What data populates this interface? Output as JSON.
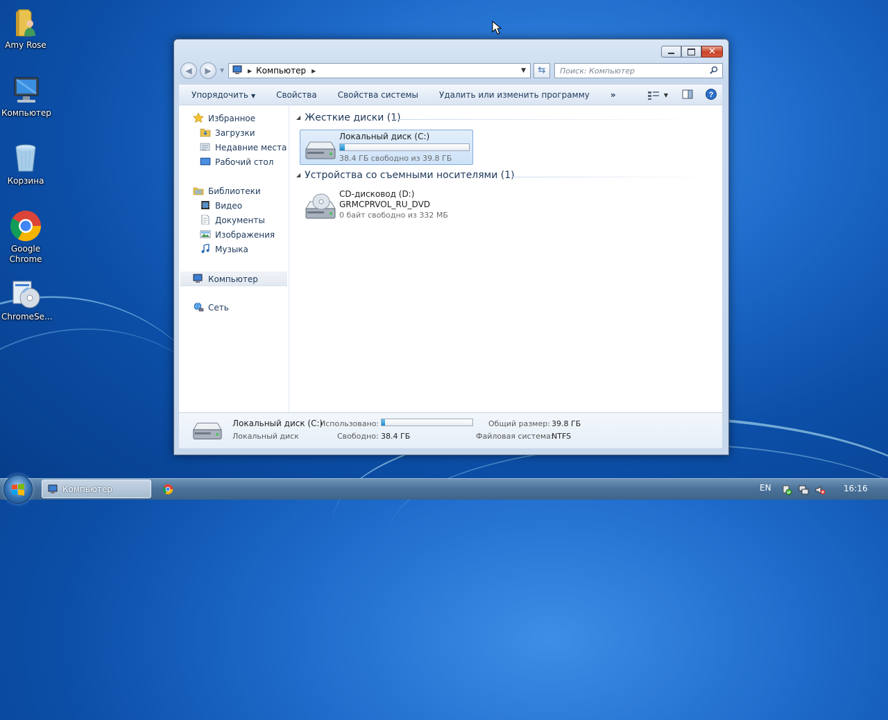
{
  "desktop": {
    "icons": [
      {
        "label": "Amy Rose"
      },
      {
        "label": "Компьютер"
      },
      {
        "label": "Корзина"
      },
      {
        "label": "Google Chrome"
      },
      {
        "label": "ChromeSe..."
      }
    ]
  },
  "window": {
    "address": {
      "location": "Компьютер"
    },
    "search": {
      "placeholder": "Поиск: Компьютер"
    },
    "toolbar": {
      "organize": "Упорядочить",
      "properties": "Свойства",
      "system_properties": "Свойства системы",
      "uninstall": "Удалить или изменить программу",
      "more": "»"
    },
    "nav": {
      "favorites": "Избранное",
      "downloads": "Загрузки",
      "recent": "Недавние места",
      "desktop": "Рабочий стол",
      "libraries": "Библиотеки",
      "video": "Видео",
      "documents": "Документы",
      "images": "Изображения",
      "music": "Музыка",
      "computer": "Компьютер",
      "network": "Сеть"
    },
    "groups": {
      "hard_drives": "Жесткие диски (1)",
      "removable": "Устройства со съемными носителями (1)"
    },
    "drives": {
      "c": {
        "name": "Локальный диск (C:)",
        "free_text": "38.4 ГБ свободно из 39.8 ГБ",
        "used_fraction": 0.035
      },
      "d": {
        "name": "CD-дисковод (D:)",
        "label": "GRMCPRVOL_RU_DVD",
        "free_text": "0 байт свободно из 332 МБ"
      }
    },
    "details": {
      "name": "Локальный диск (C:)",
      "type": "Локальный диск",
      "used_label": "Использовано:",
      "free_label": "Свободно:",
      "free_value": "38.4 ГБ",
      "total_label": "Общий размер:",
      "total_value": "39.8 ГБ",
      "fs_label": "Файловая система:",
      "fs_value": "NTFS",
      "used_fraction": 0.035
    }
  },
  "taskbar": {
    "window_button": "Компьютер",
    "language": "EN",
    "clock": "16:16"
  }
}
